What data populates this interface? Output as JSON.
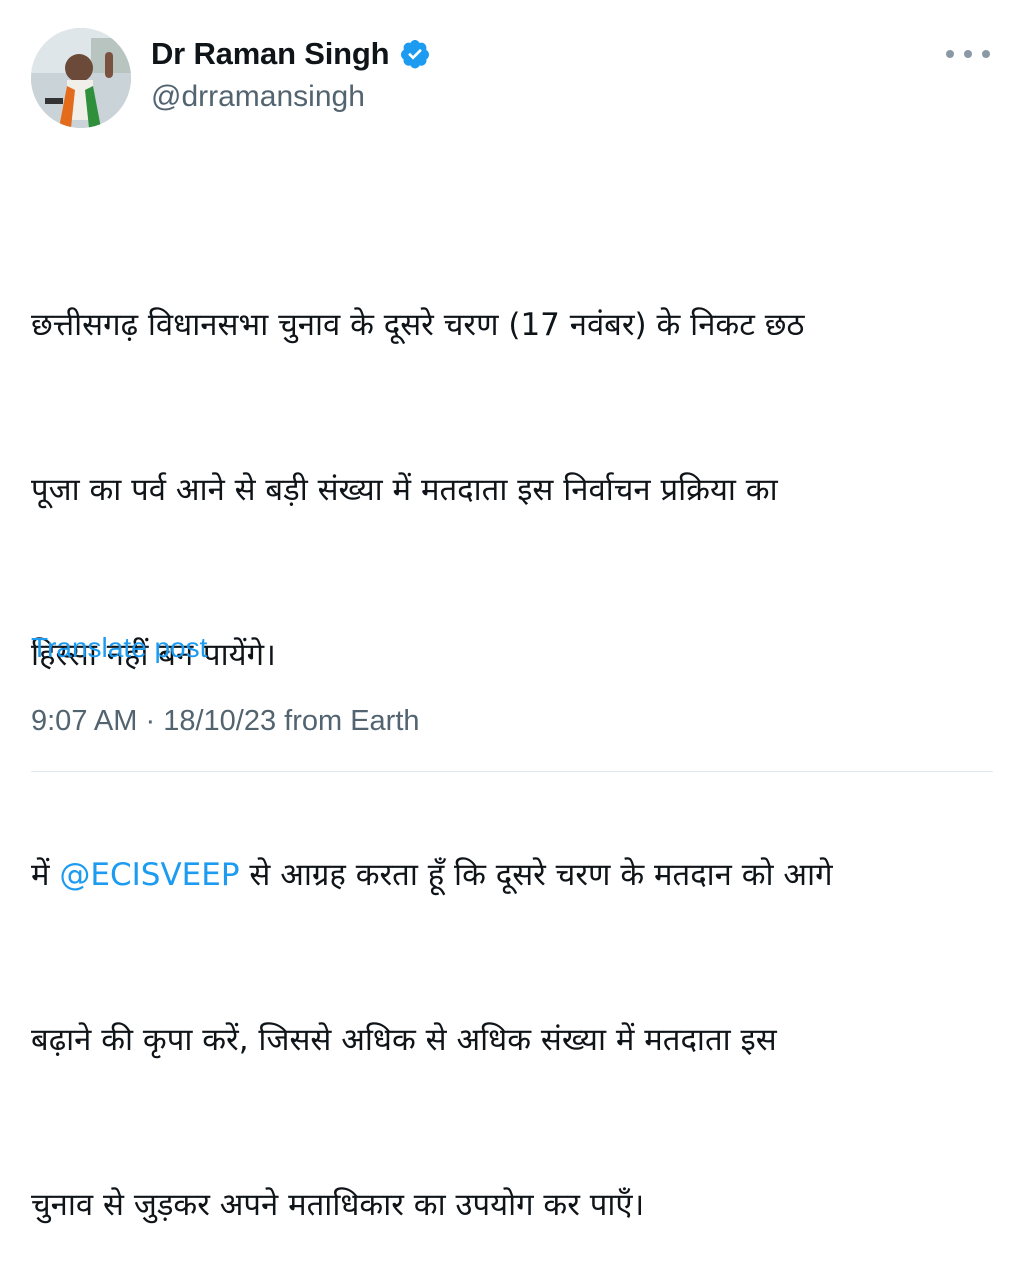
{
  "author": {
    "display_name": "Dr Raman Singh",
    "handle": "@drramansingh",
    "verified_icon": "verified-badge-icon",
    "avatar_icon": "profile-photo",
    "colors": {
      "verified": "#1d9bf0"
    }
  },
  "more_icon": "more-options-icon",
  "tweet": {
    "line1": "छत्तीसगढ़ विधानसभा चुनाव के दूसरे चरण (17 नवंबर) के निकट छठ",
    "line2": "पूजा का पर्व आने से बड़ी संख्या में मतदाता इस निर्वाचन प्रक्रिया का",
    "line3": "हिस्सा नहीं बन पायेंगे।",
    "p2_prefix": "में ",
    "mention": "@ECISVEEP",
    "p2_line1_rest": " से आग्रह करता हूँ कि दूसरे चरण के मतदान को आगे",
    "p2_line2": "बढ़ाने की कृपा करें, जिससे अधिक से अधिक संख्या में मतदाता इस",
    "p2_line3": "चुनाव से जुड़कर अपने मताधिकार का उपयोग कर पाएँ।"
  },
  "translate_label": "Translate post",
  "meta": {
    "time": "9:07 AM",
    "separator": " · ",
    "date": "18/10/23",
    "source": " from Earth"
  },
  "colors": {
    "link": "#1d9bf0",
    "muted": "#536471",
    "text": "#0f1419"
  }
}
